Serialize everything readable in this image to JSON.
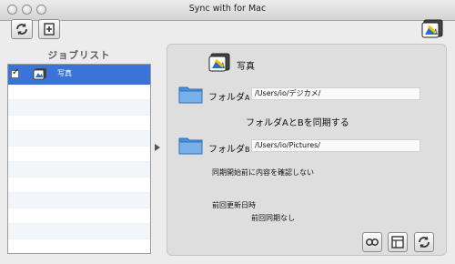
{
  "window": {
    "title": "Sync with for Mac"
  },
  "toolbar": {
    "sync_icon": "sync-icon",
    "add_icon": "add-document-icon",
    "app_icon": "photo-sync-icon"
  },
  "sidebar": {
    "heading": "ジョブリスト",
    "items": [
      {
        "label": "写真",
        "checked": true
      }
    ]
  },
  "job": {
    "name": "写真",
    "folder_a": {
      "label": "フォルダ",
      "suffix": "A",
      "path": "/Users/io/デジカメ/"
    },
    "sync_direction": "フォルダAとBを同期する",
    "folder_b": {
      "label": "フォルダ",
      "suffix": "B",
      "path": "/Users/io/Pictures/"
    },
    "confirm_option": "同期開始前に内容を確認しない",
    "last_sync_label": "前回更新日時",
    "last_sync_value": "前回同期なし"
  },
  "bottom_buttons": [
    "link-icon",
    "document-icon",
    "refresh-icon"
  ]
}
